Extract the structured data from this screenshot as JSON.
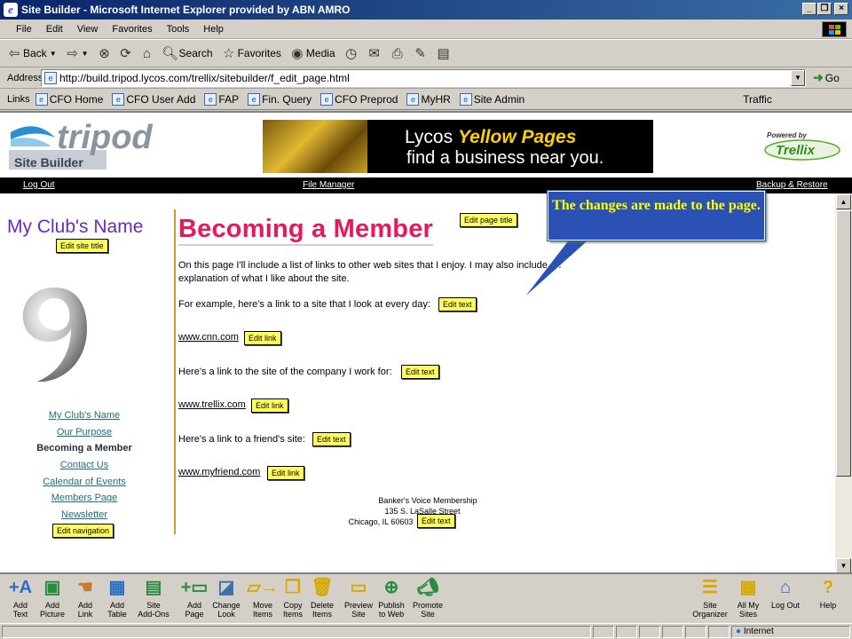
{
  "window": {
    "title": "Site Builder - Microsoft Internet Explorer provided by ABN AMRO"
  },
  "menu": [
    "File",
    "Edit",
    "View",
    "Favorites",
    "Tools",
    "Help"
  ],
  "toolbar": {
    "back": "Back",
    "search": "Search",
    "favorites": "Favorites",
    "media": "Media"
  },
  "address": {
    "label": "Address",
    "url": "http://build.tripod.lycos.com/trellix/sitebuilder/f_edit_page.html",
    "go": "Go"
  },
  "links": {
    "label": "Links",
    "items": [
      "CFO Home",
      "CFO User Add",
      "FAP",
      "Fin. Query",
      "CFO Preprod",
      "MyHR",
      "Site Admin",
      "Traffic"
    ]
  },
  "header": {
    "logo_text": "tripod",
    "logo_sub": "Site Builder",
    "ad_line1": "Lycos",
    "ad_line1_bold": "Yellow Pages",
    "ad_line2": "find a business near you.",
    "trellix_powered": "Powered by",
    "trellix_name": "Trellix"
  },
  "nav": {
    "logout": "Log Out",
    "file_manager": "File Manager",
    "backup": "Backup & Restore"
  },
  "left": {
    "site_title": "My Club's Name",
    "edit_site_title": "Edit site title",
    "nav_items": [
      "My Club's Name",
      "Our Purpose",
      "Becoming a Member",
      "Contact Us",
      "Calendar of Events",
      "Members Page",
      "Newsletter"
    ],
    "edit_navigation": "Edit navigation"
  },
  "main": {
    "page_title": "Becoming a Member",
    "edit_page_title": "Edit page title",
    "intro": "On this page I'll include a list of links to other web sites that I enjoy. I may also include an explanation of what I like about the site.",
    "p1": "For example, here's a link to a site that I look at every day:",
    "link1": "www.cnn.com",
    "p2": "Here's a link to the site of the company I work for:",
    "link2": "www.trellix.com",
    "p3": "Here's a link to a friend's site:",
    "link3": "www.myfriend.com",
    "edit_text": "Edit text",
    "edit_link": "Edit link",
    "footer_line1": "Banker's Voice Membership",
    "footer_line2": "135 S. LaSalle Street",
    "footer_line3": "Chicago, IL 60603"
  },
  "callout": "The changes are made to the page.",
  "bottom_tools": [
    {
      "label1": "Add",
      "label2": "Text",
      "icon": "add-text-icon"
    },
    {
      "label1": "Add",
      "label2": "Picture",
      "icon": "add-picture-icon"
    },
    {
      "label1": "Add",
      "label2": "Link",
      "icon": "add-link-icon"
    },
    {
      "label1": "Add",
      "label2": "Table",
      "icon": "add-table-icon"
    },
    {
      "label1": "Site",
      "label2": "Add-Ons",
      "icon": "site-addons-icon"
    },
    {
      "label1": "Add",
      "label2": "Page",
      "icon": "add-page-icon"
    },
    {
      "label1": "Change",
      "label2": "Look",
      "icon": "change-look-icon"
    },
    {
      "label1": "Move",
      "label2": "Items",
      "icon": "move-items-icon"
    },
    {
      "label1": "Copy",
      "label2": "Items",
      "icon": "copy-items-icon"
    },
    {
      "label1": "Delete",
      "label2": "Items",
      "icon": "delete-items-icon"
    },
    {
      "label1": "Preview",
      "label2": "Site",
      "icon": "preview-site-icon"
    },
    {
      "label1": "Publish",
      "label2": "to Web",
      "icon": "publish-icon"
    },
    {
      "label1": "Promote",
      "label2": "Site",
      "icon": "promote-site-icon"
    },
    {
      "label1": "Site",
      "label2": "Organizer",
      "icon": "site-organizer-icon"
    },
    {
      "label1": "All My",
      "label2": "Sites",
      "icon": "all-sites-icon"
    },
    {
      "label1": "Log Out",
      "label2": "",
      "icon": "logout-icon"
    },
    {
      "label1": "Help",
      "label2": "",
      "icon": "help-icon"
    }
  ],
  "status": {
    "zone": "Internet"
  }
}
